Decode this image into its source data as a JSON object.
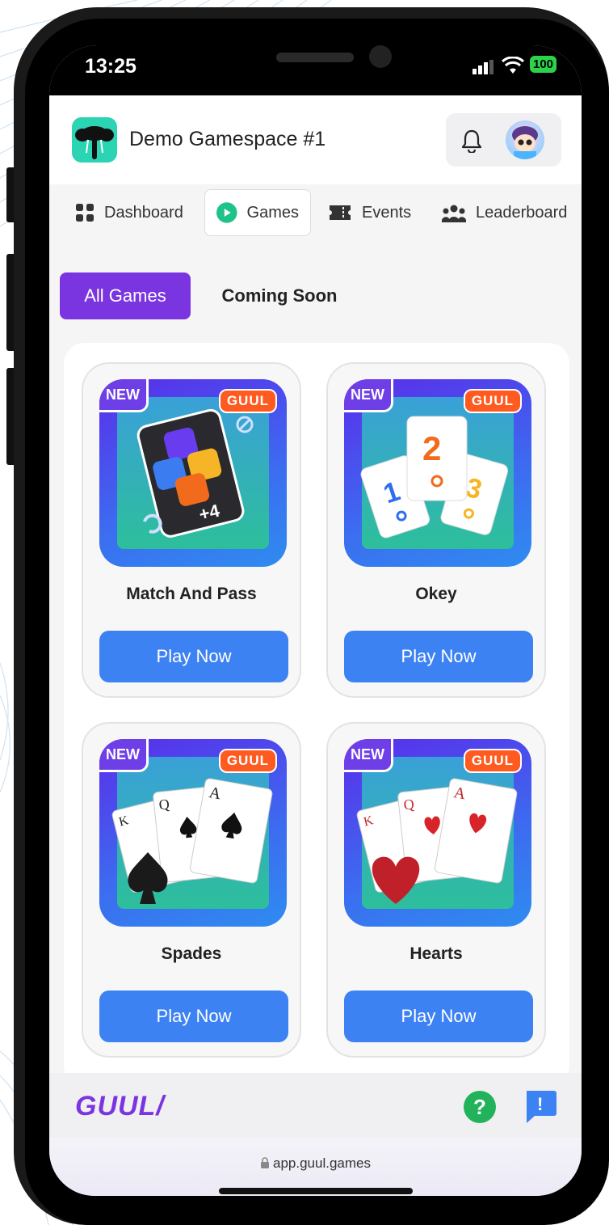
{
  "status": {
    "time": "13:25",
    "battery": "100"
  },
  "header": {
    "workspace_name": "Demo Gamespace #1"
  },
  "nav": {
    "items": [
      {
        "label": "Dashboard"
      },
      {
        "label": "Games"
      },
      {
        "label": "Events"
      },
      {
        "label": "Leaderboard"
      }
    ],
    "active": "Games"
  },
  "filters": {
    "all": "All Games",
    "coming": "Coming Soon",
    "active": "All Games"
  },
  "games": [
    {
      "title": "Match And Pass",
      "badge_new": "NEW",
      "badge_brand": "GUUL",
      "button": "Play Now"
    },
    {
      "title": "Okey",
      "badge_new": "NEW",
      "badge_brand": "GUUL",
      "button": "Play Now"
    },
    {
      "title": "Spades",
      "badge_new": "NEW",
      "badge_brand": "GUUL",
      "button": "Play Now"
    },
    {
      "title": "Hearts",
      "badge_new": "NEW",
      "badge_brand": "GUUL",
      "button": "Play Now"
    }
  ],
  "okey_tiles": [
    "1",
    "2",
    "3"
  ],
  "card_ranks": {
    "king": "K",
    "queen": "Q",
    "ace": "A",
    "plus4": "+4"
  },
  "footer": {
    "brand": "GUUL/",
    "help": "?",
    "report": "!"
  },
  "browser": {
    "url": "app.guul.games"
  },
  "colors": {
    "accent": "#7a35e0",
    "button": "#3d82f2",
    "brand_badge": "#ff5a1f",
    "help": "#22b35a"
  }
}
